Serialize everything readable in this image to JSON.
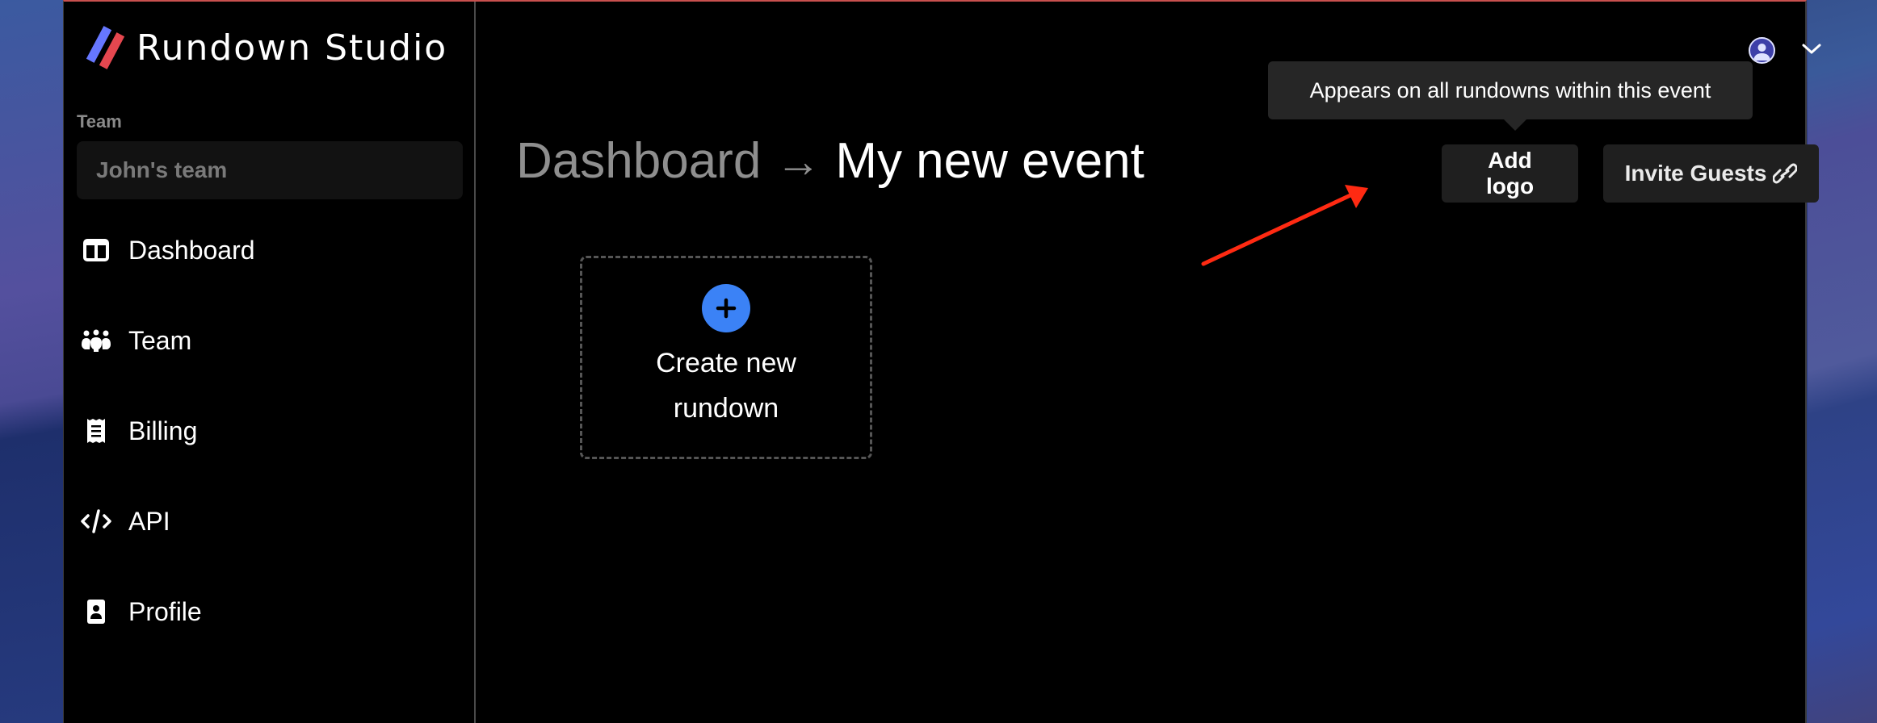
{
  "app": {
    "name": "Rundown Studio",
    "accent_color": "#3b82f6",
    "logo_colors": [
      "#6677ff",
      "#e5474f"
    ]
  },
  "sidebar": {
    "team_label": "Team",
    "team_select_value": "John's team",
    "items": [
      {
        "label": "Dashboard",
        "icon": "dashboard-icon"
      },
      {
        "label": "Team",
        "icon": "team-icon"
      },
      {
        "label": "Billing",
        "icon": "receipt-icon"
      },
      {
        "label": "API",
        "icon": "code-icon"
      },
      {
        "label": "Profile",
        "icon": "profile-badge-icon"
      }
    ]
  },
  "header": {
    "breadcrumb_parent": "Dashboard",
    "breadcrumb_separator": "→",
    "breadcrumb_current": "My new event",
    "tooltip": "Appears on all rundowns within this event",
    "add_logo_label": "Add logo",
    "invite_guests_label": "Invite Guests",
    "invite_icon": "link-icon",
    "user_icon": "user-avatar-icon",
    "menu_icon": "chevron-down-icon"
  },
  "main": {
    "create_card_label": "Create new rundown",
    "create_icon": "plus-icon"
  },
  "annotation": {
    "type": "arrow",
    "color": "#ff2a12",
    "points_to": "add-logo-button"
  }
}
